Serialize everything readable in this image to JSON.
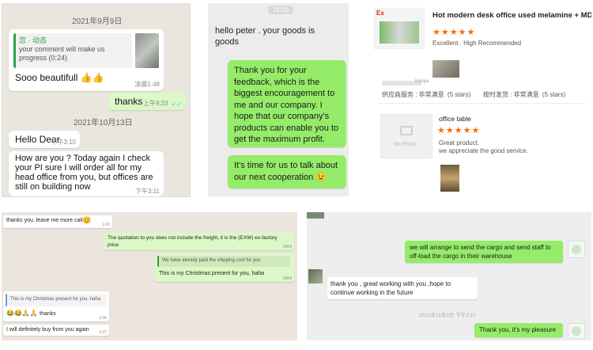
{
  "panel1": {
    "date1": "2021年9月9日",
    "reply_name": "忽 · 动态",
    "reply_text": "your comment will make us\nprogress (0:24)",
    "msg1": "Sooo beautifull",
    "msg1_emoji": "👍👍",
    "msg1_time": "凌晨1:48",
    "msg2": "thanks",
    "msg2_time": "上午9:33",
    "tick": "✓✓",
    "date2": "2021年10月13日",
    "msg3": "Hello Dear",
    "msg3_time": "下午3:10",
    "msg4": "How are you ? Today again I check\nyour PI sure I will order all for my\nhead office from you, but offices are\nstill on building now",
    "msg4_time": "下午3:11"
  },
  "panel2": {
    "time_stamp": "15:03",
    "msg1": "hello peter . your goods is\ngoods",
    "msg2": "Thank you for your\nfeedback, which is the\nbiggest encouragement to\nme and our company. I\nhope that our company's\nproducts can enable you to\nget the maximum profit.",
    "msg3": "It's time for us to talk about\nour next cooperation",
    "msg3_emoji": "😉"
  },
  "panel3": {
    "logo": "Ex",
    "product_title": "Hot modern desk office used melamine + MDF ...",
    "stars": "★★★★★",
    "review1": "Excellent . High Recommended",
    "buyer_country": "Kenya",
    "service_label": "供应商服务 : 非常满意",
    "service_stars": "(5 stars)",
    "delivery_label": "按时发货 : 非常满意",
    "delivery_stars": "(5 stars)",
    "no_photo": "No Photo",
    "product2_title": "office table",
    "review2": "Great product.\nwe appreciate the good service."
  },
  "panel4": {
    "msg1": "thanks you. leave me more calm",
    "msg1_emoji": "😊",
    "msg1_time": "1:03",
    "msg2": "The quotation to you does not include the freight, it is the (EXW) ex-factory\nprice",
    "msg2_time": "1004",
    "msg3_quote": "We have already paid the shipping cost for you",
    "msg3": "This is my Christmas present for you, haha",
    "msg3_time": "1004",
    "msg4_quote": "This is my Christmas present for you, haha",
    "msg4": "thanks",
    "msg4_emoji": "😂😂🙏🙏",
    "msg4_time": "1:06",
    "msg5": "I will definitely buy from you again",
    "msg5_time": "1:07"
  },
  "panel5": {
    "msg1": "we will arrange to send the cargo and send staff to\noff-load the cargo in their warehouse",
    "msg2": "thank you , great working with you ,hope to\ncontinue working in the future",
    "date": "2021年11月3日 下午3:10",
    "msg3": "Thank you, it's my pleasure"
  }
}
